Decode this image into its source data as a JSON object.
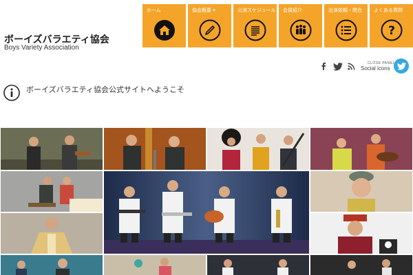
{
  "header": {
    "logo_jp": "ボーイズバラエティ協会",
    "logo_en": "Boys Variety Association"
  },
  "nav": [
    {
      "label": "ホーム",
      "icon": "home-icon"
    },
    {
      "label": "協会概要 ▾",
      "icon": "pencil-icon"
    },
    {
      "label": "公演スケジュール",
      "icon": "document-icon"
    },
    {
      "label": "会員紹介",
      "icon": "people-icon"
    },
    {
      "label": "出演依頼・問合",
      "icon": "list-icon"
    },
    {
      "label": "よくある質問",
      "icon": "question-icon"
    }
  ],
  "social": {
    "close_panel": "CLOSE PANEL",
    "label": "Social icons",
    "icons": [
      "facebook-icon",
      "twitter-icon",
      "rss-icon",
      "twitter-circle-icon"
    ]
  },
  "notice": {
    "text": "ボーイズバラエティ協会公式サイトへようこそ"
  },
  "colors": {
    "nav_bg": "#f5a42a",
    "twitter_blue": "#35a8e3"
  }
}
